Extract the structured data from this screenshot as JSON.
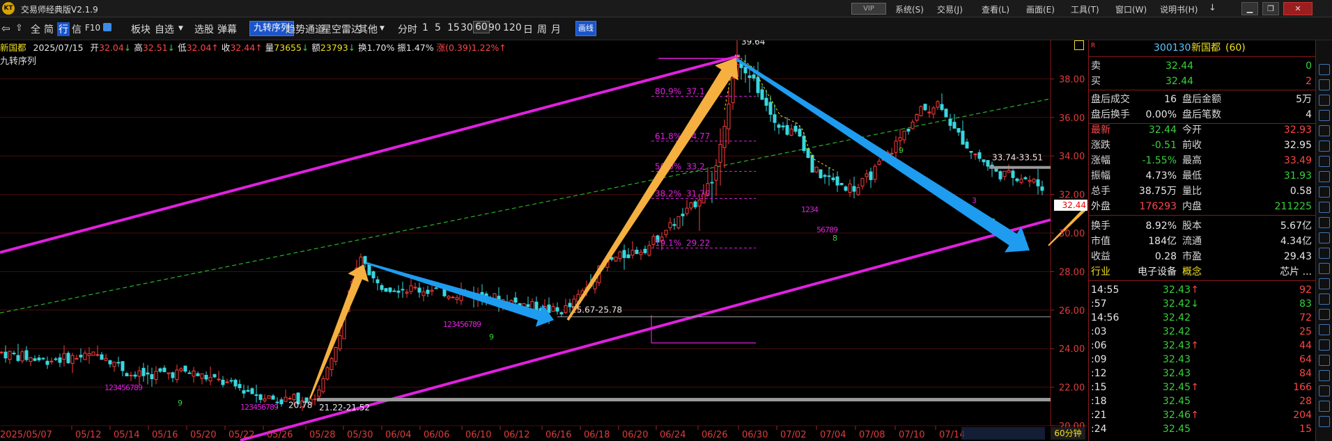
{
  "app": {
    "title": "交易师经典版V2.1.9",
    "logo_text": "KT",
    "vip": "VIP"
  },
  "menu": [
    "系统(S)",
    "交易(J)",
    "查看(L)",
    "画面(E)",
    "工具(T)",
    "窗口(W)",
    "说明书(H)"
  ],
  "toolbar": {
    "left": [
      "全",
      "简",
      "行",
      "信",
      "F10"
    ],
    "items": [
      "板块",
      "自选",
      "选股",
      "弹幕"
    ],
    "highlight": "九转序列",
    "items2": [
      "趋势通道",
      "星空雷达",
      "其他"
    ],
    "periods": [
      "分时",
      "1",
      "5",
      "15",
      "30",
      "60",
      "90",
      "120",
      "日",
      "周",
      "月"
    ],
    "selected_period": "60",
    "draw_btn": "画线"
  },
  "infobar": {
    "name": "新国都",
    "date": "2025/07/15",
    "open_label": "开",
    "open": "32.04",
    "open_dir": "↓",
    "high_label": "高",
    "high": "32.51",
    "high_dir": "↓",
    "low_label": "低",
    "low": "32.04",
    "low_dir": "↑",
    "close_label": "收",
    "close": "32.44",
    "close_dir": "↑",
    "vol_label": "量",
    "vol": "73655",
    "vol_dir": "↓",
    "amt_label": "额",
    "amt": "23793",
    "amt_dir": "↓",
    "turn_label": "换",
    "turn": "1.70%",
    "amp_label": "振",
    "amp": "1.47%",
    "chg_label": "涨",
    "chg": "(0.39)1.22%",
    "chg_dir": "↑"
  },
  "indicator_label": "九转序列",
  "quote": {
    "code": "300130",
    "name": "新国都",
    "period": "(60)",
    "sell_label": "卖",
    "sell_price": "32.44",
    "sell_vol": "0",
    "buy_label": "买",
    "buy_price": "32.44",
    "buy_vol": "2",
    "rows": [
      [
        "盘后成交",
        "16",
        "盘后金额",
        "5万"
      ],
      [
        "盘后换手",
        "0.00%",
        "盘后笔数",
        "4"
      ],
      [
        "最新",
        "32.44",
        "今开",
        "32.93"
      ],
      [
        "涨跌",
        "-0.51",
        "前收",
        "32.95"
      ],
      [
        "涨幅",
        "-1.55%",
        "最高",
        "33.49"
      ],
      [
        "振幅",
        "4.73%",
        "最低",
        "31.93"
      ],
      [
        "总手",
        "38.75万",
        "量比",
        "0.58"
      ],
      [
        "外盘",
        "176293",
        "内盘",
        "211225"
      ],
      [
        "换手",
        "8.92%",
        "股本",
        "5.67亿"
      ],
      [
        "市值",
        "184亿",
        "流通",
        "4.34亿"
      ],
      [
        "收益",
        "0.28",
        "市盈",
        "29.43"
      ],
      [
        "行业",
        "电子设备",
        "概念",
        "芯片 ..."
      ]
    ]
  },
  "ticks": [
    {
      "time": "14:55",
      "price": "32.43",
      "dir": "↑",
      "vol": "92"
    },
    {
      "time": ":57",
      "price": "32.42",
      "dir": "↓",
      "vol": "83"
    },
    {
      "time": "14:56",
      "price": "32.42",
      "dir": "",
      "vol": "72"
    },
    {
      "time": ":03",
      "price": "32.42",
      "dir": "",
      "vol": "25"
    },
    {
      "time": ":06",
      "price": "32.43",
      "dir": "↑",
      "vol": "44"
    },
    {
      "time": ":09",
      "price": "32.43",
      "dir": "",
      "vol": "64"
    },
    {
      "time": ":12",
      "price": "32.43",
      "dir": "",
      "vol": "84"
    },
    {
      "time": ":15",
      "price": "32.45",
      "dir": "↑",
      "vol": "166"
    },
    {
      "time": ":18",
      "price": "32.45",
      "dir": "",
      "vol": "28"
    },
    {
      "time": ":21",
      "price": "32.46",
      "dir": "↑",
      "vol": "204"
    },
    {
      "time": ":24",
      "price": "32.45",
      "dir": "",
      "vol": "15"
    }
  ],
  "colors": {
    "up": "#ff3c3c",
    "down": "#38d7e0",
    "channel": "#e020e0",
    "arrow_up": "#f5b040",
    "arrow_down": "#1e9cf0",
    "accent": "#1b55c9"
  },
  "chart_data": {
    "type": "candlestick",
    "y_ticks": [
      20.0,
      22.0,
      24.0,
      26.0,
      28.0,
      30.0,
      32.0,
      34.0,
      36.0,
      38.0
    ],
    "ylim": [
      20.0,
      40.0
    ],
    "x_labels": [
      "2025/05/07",
      "05/12",
      "05/14",
      "05/16",
      "05/20",
      "05/22",
      "05/26",
      "05/28",
      "05/30",
      "06/04",
      "06/06",
      "06/10",
      "06/12",
      "06/16",
      "06/18",
      "06/20",
      "06/24",
      "06/26",
      "06/30",
      "07/02",
      "07/04",
      "07/08",
      "07/10",
      "07/14"
    ],
    "period_label": "60分钟",
    "current_price": "32.44",
    "annotations": [
      {
        "text": "39.64",
        "price": 39.64
      },
      {
        "text": "20.78",
        "price": 20.78
      },
      {
        "text": "21.22-21.52",
        "price": 21.37
      },
      {
        "text": "25.67-25.78",
        "price": 25.72
      },
      {
        "text": "33.74-33.51",
        "price": 33.62
      }
    ],
    "fib_levels": [
      {
        "text": "80.9%",
        "value": "37.1",
        "price": 37.1
      },
      {
        "text": "61.8%",
        "value": "34.77",
        "price": 34.77
      },
      {
        "text": "50.0%",
        "value": "33.2",
        "price": 33.2
      },
      {
        "text": "38.2%",
        "value": "31.79",
        "price": 31.79
      },
      {
        "text": "19.1%",
        "value": "29.22",
        "price": 29.22
      }
    ],
    "nine_markers": [
      "123456789",
      "123456789",
      "123456789",
      "1234",
      "56789",
      "9",
      "9",
      "8",
      "8",
      "9",
      "3"
    ]
  }
}
